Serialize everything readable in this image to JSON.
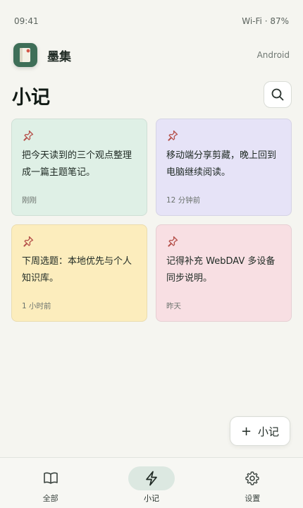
{
  "status_bar": {
    "time": "09:41",
    "network": "Wi-Fi · 87%"
  },
  "header": {
    "app_name": "墨集",
    "platform": "Android"
  },
  "page": {
    "title": "小记"
  },
  "notes": [
    {
      "text": "把今天读到的三个观点整理成一篇主题笔记。",
      "time": "刚刚",
      "color": "#dff0e6"
    },
    {
      "text": "移动端分享剪藏，晚上回到电脑继续阅读。",
      "time": "12 分钟前",
      "color": "#e6e3f7"
    },
    {
      "text": "下周选题：本地优先与个人知识库。",
      "time": "1 小时前",
      "color": "#fcedbd"
    },
    {
      "text": "记得补充 WebDAV 多设备同步说明。",
      "time": "昨天",
      "color": "#f8dfe3"
    }
  ],
  "fab": {
    "label": "小记"
  },
  "bottom_nav": [
    {
      "label": "全部",
      "icon": "book-icon",
      "active": false
    },
    {
      "label": "小记",
      "icon": "lightning-icon",
      "active": true
    },
    {
      "label": "设置",
      "icon": "gear-icon",
      "active": false
    }
  ],
  "colors": {
    "accent": "#3e6e58",
    "background": "#f5f5f0",
    "pin": "#b5504a"
  }
}
